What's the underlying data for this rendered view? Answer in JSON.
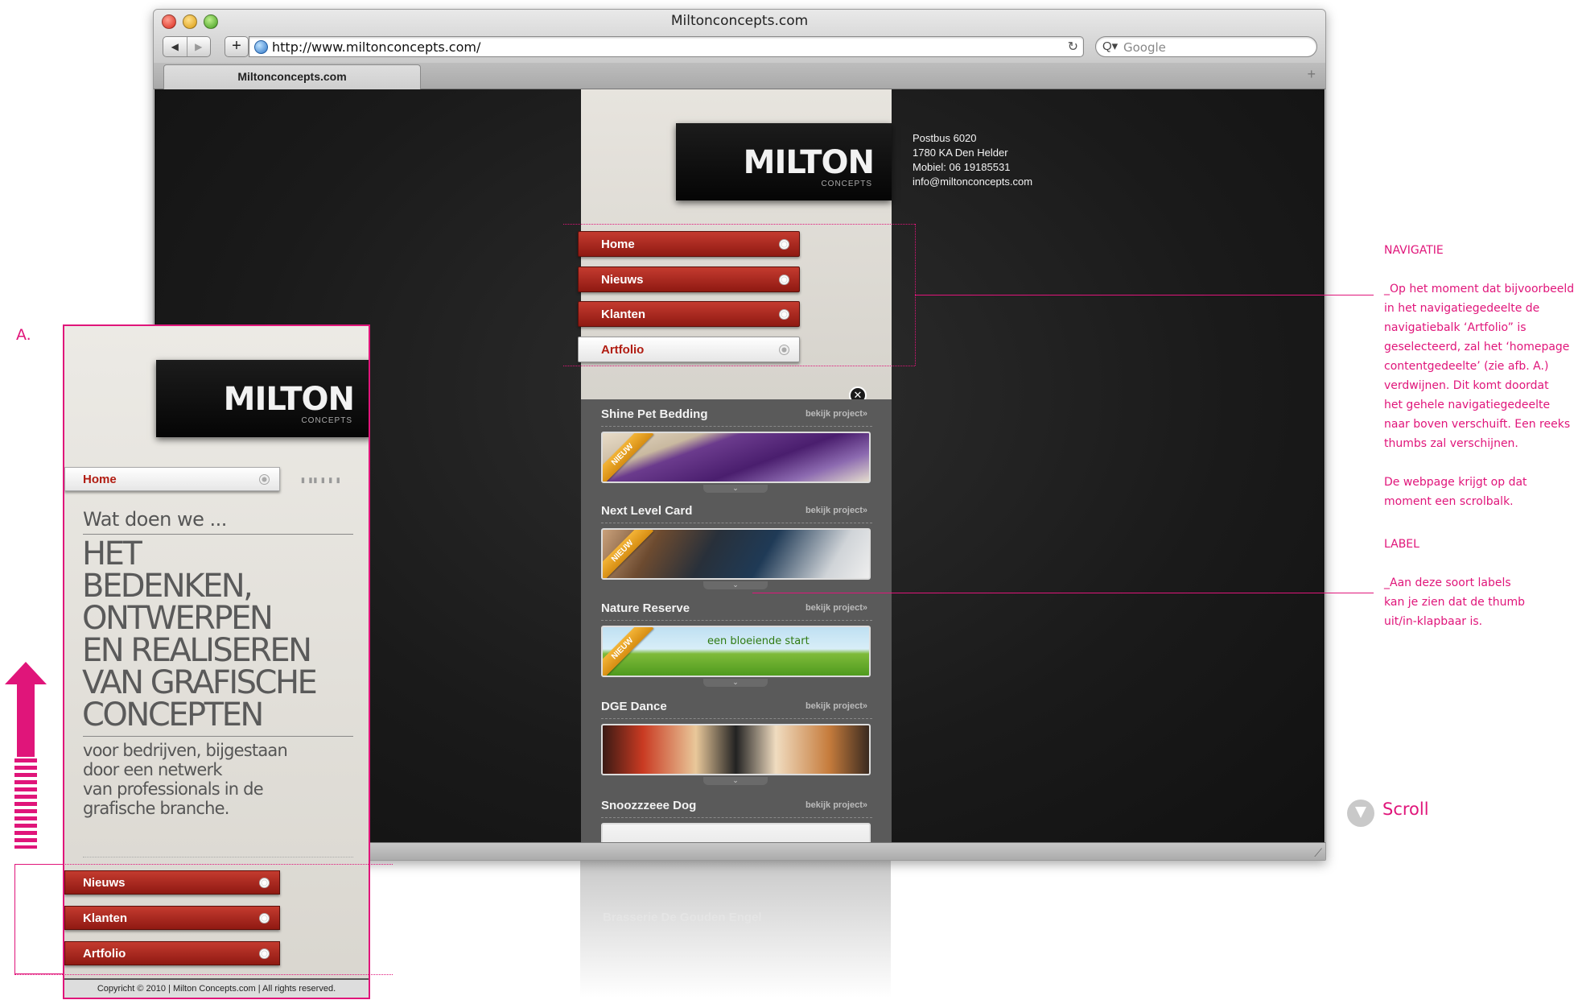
{
  "browser": {
    "window_title": "Miltonconcepts.com",
    "url": "http://www.miltonconcepts.com/",
    "search_placeholder": "Google",
    "tab_label": "Miltonconcepts.com",
    "add_tab": "+",
    "add_bookmark": "+",
    "back_icon": "◀",
    "forward_icon": "▶",
    "reload_icon": "↻",
    "search_icon": "Q▾"
  },
  "site": {
    "logo_main": "MILTON",
    "logo_sub": "CONCEPTS",
    "address": {
      "line1": "Postbus 6020",
      "line2": "1780 KA Den Helder",
      "line3": "Mobiel: 06 19185531",
      "line4": "info@miltonconcepts.com"
    },
    "nav": [
      {
        "label": "Home",
        "active": false
      },
      {
        "label": "Nieuws",
        "active": false
      },
      {
        "label": "Klanten",
        "active": false
      },
      {
        "label": "Artfolio",
        "active": true
      }
    ],
    "close_icon": "✕",
    "projects": [
      {
        "name": "Shine Pet Bedding",
        "link": "bekijk project»",
        "badge": "NIEUW"
      },
      {
        "name": "Next Level Card",
        "link": "bekijk project»",
        "badge": "NIEUW"
      },
      {
        "name": "Nature Reserve",
        "link": "bekijk project»",
        "badge": "NIEUW",
        "tagline": "een bloeiende start"
      },
      {
        "name": "DGE Dance",
        "link": "bekijk project»",
        "badge": ""
      },
      {
        "name": "Snoozzzeee Dog",
        "link": "bekijk project»",
        "badge": ""
      }
    ],
    "reflection_label": "Brasserie De Gouden Engel"
  },
  "panel_a": {
    "label": "A.",
    "logo_main": "MILTON",
    "logo_sub": "CONCEPTS",
    "nav_home": "Home",
    "intro": "Wat doen we ...",
    "headline": [
      "HET",
      "BEDENKEN,",
      "ONTWERPEN",
      "EN REALISEREN",
      "VAN GRAFISCHE",
      "CONCEPTEN"
    ],
    "sub": [
      "voor bedrijven, bijgestaan",
      "door een netwerk",
      "van professionals in de",
      "grafische branche."
    ],
    "nav_bottom": [
      "Nieuws",
      "Klanten",
      "Artfolio"
    ],
    "footer": "Copyricht © 2010 | Milton Concepts.com | All rights reserved."
  },
  "annotations": {
    "nav_title": "NAVIGATIE",
    "nav_text": [
      "_Op het moment dat bijvoorbeeld",
      "in het navigatiegedeelte de",
      "navigatiebalk ‘Artfolio” is",
      "geselecteerd, zal het ‘homepage",
      "contentgedeelte’ (zie afb. A.)",
      "verdwijnen. Dit komt doordat",
      "het gehele navigatiegedeelte",
      "naar boven verschuift. Een reeks",
      "thumbs zal verschijnen."
    ],
    "nav_text2": [
      "De webpage krijgt op dat",
      "moment een scrolbalk."
    ],
    "label_title": "LABEL",
    "label_text": [
      "_Aan deze soort labels",
      "kan je zien dat de thumb",
      "uit/in-klapbaar is."
    ],
    "scroll": "Scroll"
  },
  "colors": {
    "accent": "#e0157a",
    "nav_red": "#b11d12",
    "page_bg": "#1a1a1a"
  }
}
